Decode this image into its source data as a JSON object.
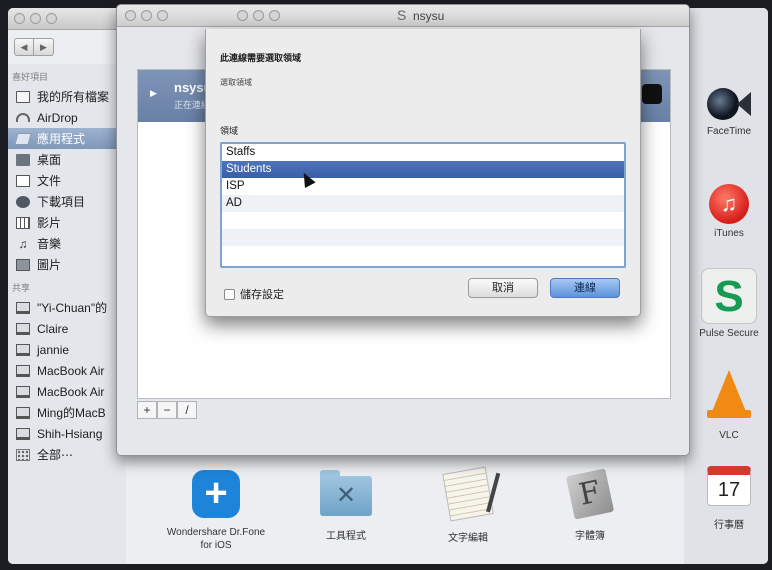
{
  "finder": {
    "sidebar": {
      "favorites_header": "喜好項目",
      "favorites": [
        {
          "label": "我的所有檔案",
          "icon": "all-files-icon"
        },
        {
          "label": "AirDrop",
          "icon": "airdrop-icon"
        },
        {
          "label": "應用程式",
          "icon": "applications-icon",
          "selected": true
        },
        {
          "label": "桌面",
          "icon": "desktop-icon"
        },
        {
          "label": "文件",
          "icon": "documents-icon"
        },
        {
          "label": "下載項目",
          "icon": "downloads-icon"
        },
        {
          "label": "影片",
          "icon": "movies-icon"
        },
        {
          "label": "音樂",
          "icon": "music-icon"
        },
        {
          "label": "圖片",
          "icon": "pictures-icon"
        }
      ],
      "shared_header": "共享",
      "shared": [
        {
          "label": "\"Yi-Chuan\"的",
          "icon": "computer-icon"
        },
        {
          "label": "Claire",
          "icon": "computer-icon"
        },
        {
          "label": "jannie",
          "icon": "computer-icon"
        },
        {
          "label": "MacBook Air",
          "icon": "computer-icon"
        },
        {
          "label": "MacBook Air",
          "icon": "computer-icon"
        },
        {
          "label": "Ming的MacB",
          "icon": "computer-icon"
        },
        {
          "label": "Shih-Hsiang",
          "icon": "computer-icon"
        },
        {
          "label": "全部⋯",
          "icon": "network-icon"
        }
      ]
    },
    "apps_right": [
      {
        "label": "FaceTime",
        "icon": "facetime-icon"
      },
      {
        "label": "iTunes",
        "icon": "itunes-icon"
      },
      {
        "label": "Pulse Secure",
        "icon": "pulse-secure-icon"
      },
      {
        "label": "VLC",
        "icon": "vlc-icon"
      },
      {
        "label": "行事曆",
        "icon": "calendar-icon",
        "day": "17"
      }
    ],
    "apps_bottom": [
      {
        "label": "Wondershare Dr.Fone for iOS",
        "icon": "drfone-icon"
      },
      {
        "label": "工具程式",
        "icon": "utilities-folder-icon"
      },
      {
        "label": "文字編輯",
        "icon": "textedit-icon"
      },
      {
        "label": "字體簿",
        "icon": "fontbook-icon"
      }
    ]
  },
  "vpn_window": {
    "title": "nsysu",
    "connection": {
      "name": "nsysu",
      "status": "正在連線..."
    },
    "toolbar": {
      "add": "+",
      "remove": "−",
      "edit": "/"
    }
  },
  "dialog": {
    "heading": "此連線需要選取領域",
    "subheading": "選取領域",
    "domain_label": "領域",
    "domains": [
      "Staffs",
      "Students",
      "ISP",
      "AD"
    ],
    "selected_domain": "Students",
    "save_settings_label": "儲存設定",
    "cancel_label": "取消",
    "connect_label": "連線"
  }
}
